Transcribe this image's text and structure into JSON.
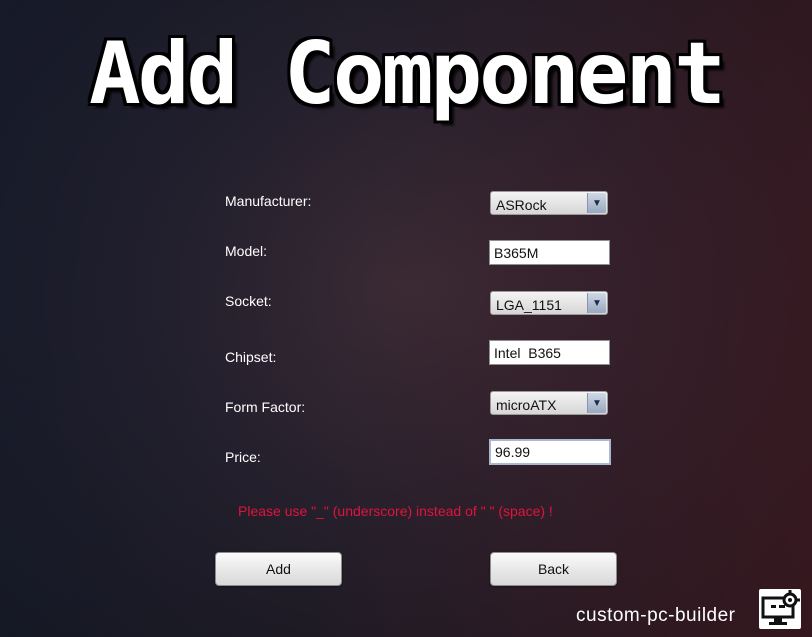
{
  "title": "Add Component",
  "form": {
    "manufacturer": {
      "label": "Manufacturer:",
      "value": "ASRock"
    },
    "model": {
      "label": "Model:",
      "value": "B365M"
    },
    "socket": {
      "label": "Socket:",
      "value": "LGA_1151"
    },
    "chipset": {
      "label": "Chipset:",
      "value": "Intel  B365"
    },
    "form_factor": {
      "label": "Form Factor:",
      "value": "microATX"
    },
    "price": {
      "label": "Price:",
      "value": "96.99"
    }
  },
  "warning": "Please use \"_\" (underscore) instead of \" \" (space) !",
  "buttons": {
    "add": "Add",
    "back": "Back"
  },
  "brand": "custom-pc-builder",
  "icons": {
    "dropdown": "chevron-down-icon",
    "logo": "monitor-gear-logo-icon"
  },
  "colors": {
    "warning": "#e0143c",
    "text": "#ffffff"
  }
}
